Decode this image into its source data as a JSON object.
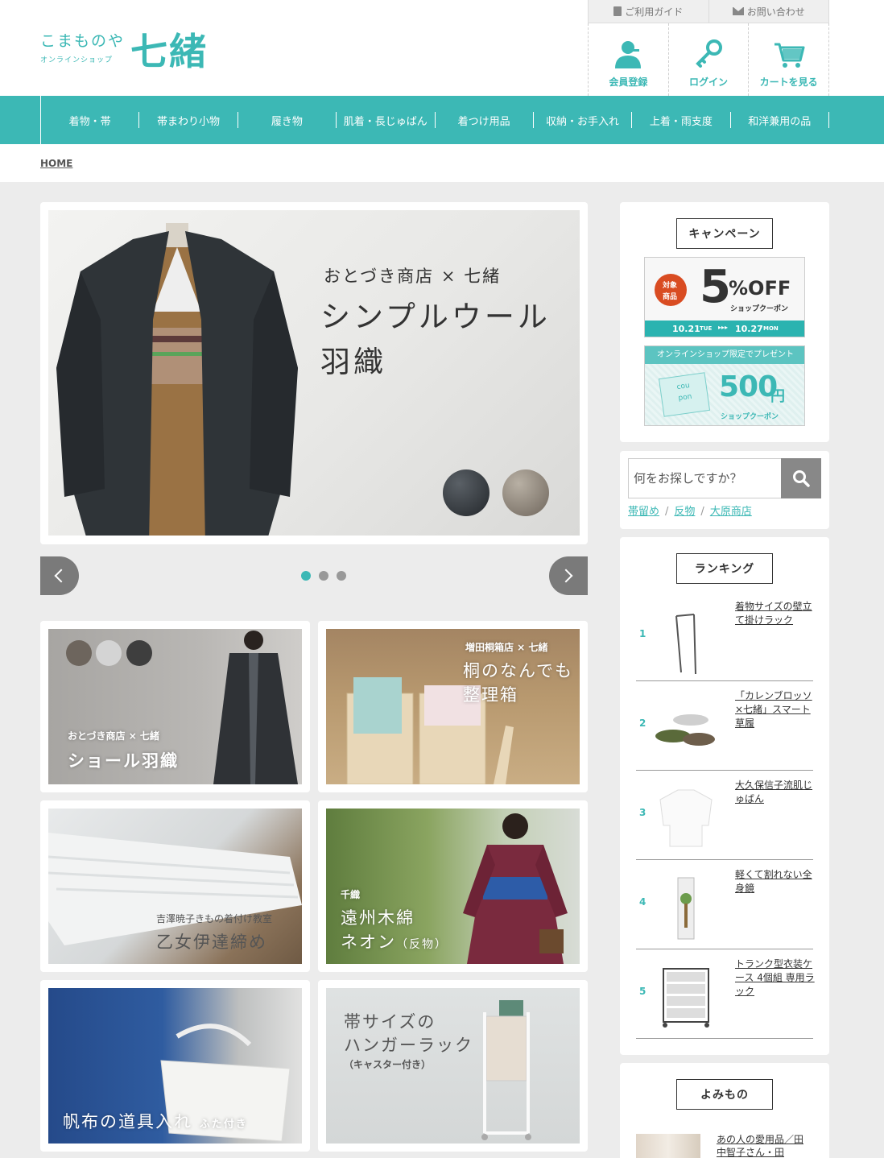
{
  "brand": {
    "name_kana": "こまものや",
    "name_sub": "オンラインショップ",
    "name_kanji": "七緒"
  },
  "util_nav": {
    "guide": "ご利用ガイド",
    "contact": "お問い合わせ"
  },
  "member_nav": {
    "register": "会員登録",
    "login": "ログイン",
    "cart": "カートを見る"
  },
  "colors": {
    "accent": "#3cb8b5",
    "background": "#ececec"
  },
  "global_nav": [
    "着物・帯",
    "帯まわり小物",
    "履き物",
    "肌着・長じゅばん",
    "着つけ用品",
    "収納・お手入れ",
    "上着・雨支度",
    "和洋兼用の品"
  ],
  "breadcrumb": {
    "home": "HOME"
  },
  "slider": {
    "line1": "おとづき商店 × 七緒",
    "line2": "シンプルウール",
    "line3": "羽織",
    "dots": 3,
    "active_dot": 0
  },
  "banners": {
    "b1": {
      "sub": "おとづき商店 × 七緒",
      "title": "ショール羽織"
    },
    "b2": {
      "sub": "増田桐箱店 × 七緒",
      "title1": "桐のなんでも",
      "title2": "整理箱"
    },
    "b3": {
      "sub": "吉澤暁子きもの着付け教室",
      "title": "乙女伊達締め"
    },
    "b4": {
      "sub": "千織",
      "title1": "遠州木綿",
      "title2": "ネオン",
      "title2_sub": "（反物）"
    },
    "b5": {
      "title": "帆布の道具入れ",
      "title_sub": "ふた付き"
    },
    "b6": {
      "title1": "帯サイズの",
      "title2": "ハンガーラック",
      "title3": "（キャスター付き）"
    }
  },
  "campaign": {
    "title": "キャンペーン",
    "c1": {
      "badge1": "対象",
      "badge2": "商品",
      "big": "5",
      "pct": "%OFF",
      "label": "ショップクーポン",
      "start": "10.21",
      "start_day": "TUE",
      "end": "10.27",
      "end_day": "MON"
    },
    "c2": {
      "header": "オンラインショップ限定でプレゼント",
      "card1": "cou",
      "card2": "pon",
      "amount": "500",
      "unit": "円",
      "label": "ショップクーポン"
    }
  },
  "search": {
    "placeholder": "何をお探しですか？",
    "tags": [
      "帯留め",
      "反物",
      "大原商店"
    ]
  },
  "ranking": {
    "title": "ランキング",
    "items": [
      {
        "no": "1",
        "name": "着物サイズの壁立て掛けラック"
      },
      {
        "no": "2",
        "name": "「カレンブロッソ×七緒」スマート草履"
      },
      {
        "no": "3",
        "name": "大久保信子流肌じゅばん"
      },
      {
        "no": "4",
        "name": "軽くて割れない全身鏡"
      },
      {
        "no": "5",
        "name": "トランク型衣装ケース 4個組 専用ラック"
      }
    ]
  },
  "reading": {
    "title": "よみもの",
    "item1": "あの人の愛用品／田中智子さん・田"
  }
}
